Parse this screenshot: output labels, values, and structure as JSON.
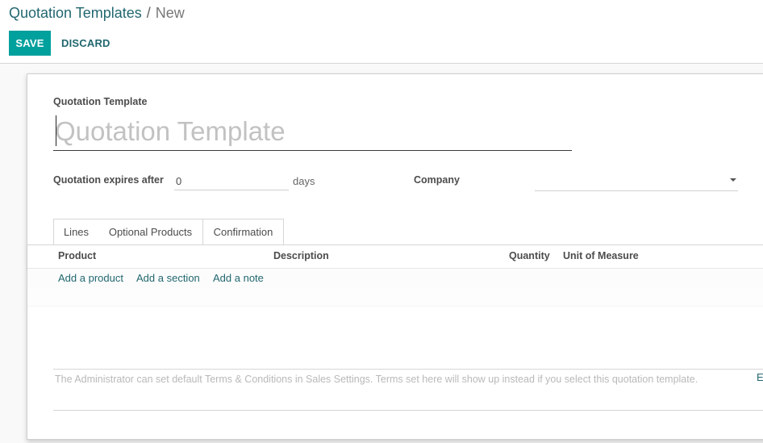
{
  "breadcrumb": {
    "parent": "Quotation Templates",
    "separator": "/",
    "current": "New"
  },
  "toolbar": {
    "save_label": "SAVE",
    "discard_label": "DISCARD"
  },
  "form": {
    "name_label": "Quotation Template",
    "name_placeholder": "Quotation Template",
    "name_value": "",
    "expires_label": "Quotation expires after",
    "expires_value": "0",
    "expires_unit": "days",
    "company_label": "Company",
    "company_value": ""
  },
  "tabs": [
    {
      "label": "Lines",
      "active": true
    },
    {
      "label": "Optional Products",
      "active": false
    },
    {
      "label": "Confirmation",
      "active": false
    }
  ],
  "lines_table": {
    "columns": [
      "Product",
      "Description",
      "Quantity",
      "Unit of Measure"
    ],
    "add_links": [
      "Add a product",
      "Add a section",
      "Add a note"
    ]
  },
  "terms_placeholder": "The Administrator can set default Terms & Conditions in Sales Settings. Terms set here will show up instead if you select this quotation template.",
  "edge_link_text": "E",
  "colors": {
    "primary": "#00a09d",
    "link": "#21676f",
    "text": "#4c4c4c"
  },
  "icons": {
    "company_dropdown": "caret-down-icon"
  }
}
